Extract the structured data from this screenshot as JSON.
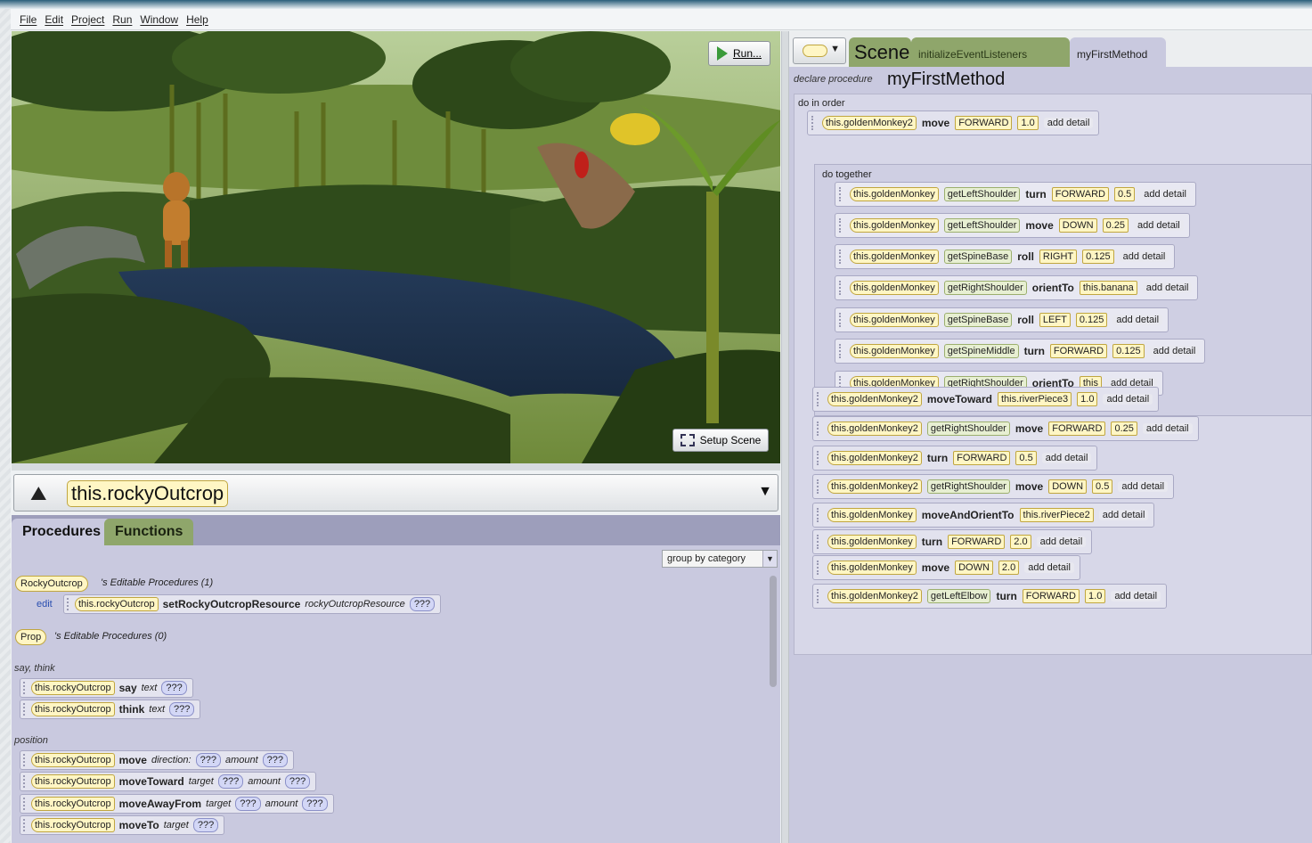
{
  "menu": [
    "File",
    "Edit",
    "Project",
    "Run",
    "Window",
    "Help"
  ],
  "scene": {
    "run_label": "Run...",
    "setup_label": "Setup Scene"
  },
  "entity": {
    "name": "this.rockyOutcrop"
  },
  "left_tabs": {
    "procedures": "Procedures",
    "functions": "Functions"
  },
  "procedures_panel": {
    "group_by": "group by category",
    "class1": "RockyOutcrop",
    "class1_suffix": "'s Editable Procedures (1)",
    "edit": "edit",
    "set_proc": {
      "subject": "this.rockyOutcrop",
      "method": "setRockyOutcropResource",
      "param": "rockyOutcropResource",
      "value": "???"
    },
    "class2": "Prop",
    "class2_suffix": "'s Editable Procedures (0)",
    "cat_say": "say, think",
    "cat_position": "position",
    "tiles": [
      {
        "subject": "this.rockyOutcrop",
        "method": "say",
        "p1": "text",
        "v1": "???"
      },
      {
        "subject": "this.rockyOutcrop",
        "method": "think",
        "p1": "text",
        "v1": "???"
      },
      {
        "subject": "this.rockyOutcrop",
        "method": "move",
        "p1": "direction:",
        "v1": "???",
        "p2": "amount",
        "v2": "???"
      },
      {
        "subject": "this.rockyOutcrop",
        "method": "moveToward",
        "p1": "target",
        "v1": "???",
        "p2": "amount",
        "v2": "???"
      },
      {
        "subject": "this.rockyOutcrop",
        "method": "moveAwayFrom",
        "p1": "target",
        "v1": "???",
        "p2": "amount",
        "v2": "???"
      },
      {
        "subject": "this.rockyOutcrop",
        "method": "moveTo",
        "p1": "target",
        "v1": "???"
      }
    ]
  },
  "editor": {
    "tabs": {
      "scene": "Scene",
      "init": "initializeEventListeners",
      "method": "myFirstMethod"
    },
    "declare": "declare procedure",
    "method_name": "myFirstMethod",
    "do_in_order": "do in order",
    "do_together": "do together",
    "add_detail": "add detail",
    "first": {
      "subject": "this.goldenMonkey2",
      "method": "move",
      "arg1": "FORWARD",
      "arg2": "1.0"
    },
    "together": [
      {
        "subject": "this.goldenMonkey",
        "joint": "getLeftShoulder",
        "method": "turn",
        "arg1": "FORWARD",
        "arg2": "0.5"
      },
      {
        "subject": "this.goldenMonkey",
        "joint": "getLeftShoulder",
        "method": "move",
        "arg1": "DOWN",
        "arg2": "0.25"
      },
      {
        "subject": "this.goldenMonkey",
        "joint": "getSpineBase",
        "method": "roll",
        "arg1": "RIGHT",
        "arg2": "0.125"
      },
      {
        "subject": "this.goldenMonkey",
        "joint": "getRightShoulder",
        "method": "orientTo",
        "arg1": "this.banana"
      },
      {
        "subject": "this.goldenMonkey",
        "joint": "getSpineBase",
        "method": "roll",
        "arg1": "LEFT",
        "arg2": "0.125"
      },
      {
        "subject": "this.goldenMonkey",
        "joint": "getSpineMiddle",
        "method": "turn",
        "arg1": "FORWARD",
        "arg2": "0.125"
      },
      {
        "subject": "this.goldenMonkey",
        "joint": "getRightShoulder",
        "method": "orientTo",
        "arg1": "this"
      }
    ],
    "after": [
      {
        "subject": "this.goldenMonkey2",
        "method": "moveToward",
        "arg1": "this.riverPiece3",
        "arg2": "1.0"
      },
      {
        "subject": "this.goldenMonkey2",
        "joint": "getRightShoulder",
        "method": "move",
        "arg1": "FORWARD",
        "arg2": "0.25"
      },
      {
        "subject": "this.goldenMonkey2",
        "method": "turn",
        "arg1": "FORWARD",
        "arg2": "0.5"
      },
      {
        "subject": "this.goldenMonkey2",
        "joint": "getRightShoulder",
        "method": "move",
        "arg1": "DOWN",
        "arg2": "0.5"
      },
      {
        "subject": "this.goldenMonkey",
        "method": "moveAndOrientTo",
        "arg1": "this.riverPiece2"
      },
      {
        "subject": "this.goldenMonkey",
        "method": "turn",
        "arg1": "FORWARD",
        "arg2": "2.0"
      },
      {
        "subject": "this.goldenMonkey",
        "method": "move",
        "arg1": "DOWN",
        "arg2": "2.0"
      },
      {
        "subject": "this.goldenMonkey2",
        "joint": "getLeftElbow",
        "method": "turn",
        "arg1": "FORWARD",
        "arg2": "1.0"
      }
    ]
  }
}
